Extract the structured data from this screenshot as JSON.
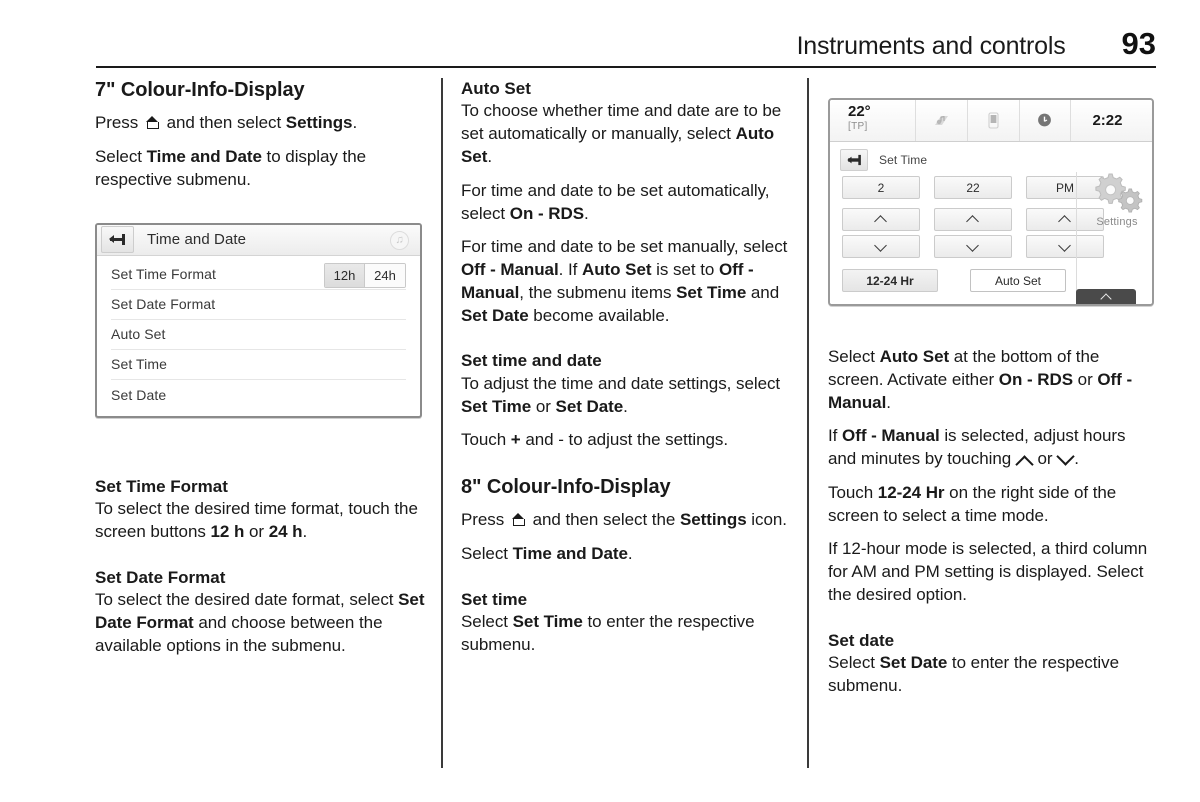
{
  "header": {
    "title": "Instruments and controls",
    "page_number": "93"
  },
  "col1": {
    "heading": "7\" Colour-Info-Display",
    "p1_a": "Press ",
    "p1_b": " and then select ",
    "p1_bold": "Settings",
    "p1_c": ".",
    "p2_a": "Select ",
    "p2_bold": "Time and Date",
    "p2_b": " to display the respective submenu.",
    "sub1_title": "Set Time Format",
    "sub1_a": "To select the desired time format, touch the screen buttons ",
    "sub1_b1": "12 h",
    "sub1_mid": " or ",
    "sub1_b2": "24 h",
    "sub1_end": ".",
    "sub2_title": "Set Date Format",
    "sub2_a": "To select the desired date format, select ",
    "sub2_bold": "Set Date Format",
    "sub2_b": " and choose between the available options in the submenu."
  },
  "menu_figure": {
    "back_icon": "back-arrow-icon",
    "title": "Time and Date",
    "music_icon": "♫",
    "rows": [
      {
        "label": "Set Time Format",
        "has_toggle": true
      },
      {
        "label": "Set Date Format",
        "has_toggle": false
      },
      {
        "label": "Auto Set",
        "has_toggle": false
      },
      {
        "label": "Set Time",
        "has_toggle": false
      },
      {
        "label": "Set Date",
        "has_toggle": false
      }
    ],
    "toggle_12h": "12h",
    "toggle_24h": "24h"
  },
  "col2": {
    "sub1_title": "Auto Set",
    "sub1_a": "To choose whether time and date are to be set automatically or manually, select ",
    "sub1_bold": "Auto Set",
    "sub1_end": ".",
    "p1_a": "For time and date to be set automatically, select ",
    "p1_bold": "On - RDS",
    "p1_end": ".",
    "p2_a": "For time and date to be set manually, select ",
    "p2_b1": "Off - Manual",
    "p2_b": ". If ",
    "p2_b2": "Auto Set",
    "p2_c": " is set to ",
    "p2_b3": "Off - Manual",
    "p2_d": ", the submenu items ",
    "p2_b4": "Set Time",
    "p2_e": " and ",
    "p2_b5": "Set Date",
    "p2_f": " become available.",
    "sub2_title": "Set time and date",
    "p3_a": "To adjust the time and date settings, select ",
    "p3_b1": "Set Time",
    "p3_mid": " or ",
    "p3_b2": "Set Date",
    "p3_end": ".",
    "p4_a": "Touch ",
    "p4_b": "+",
    "p4_c": " and - to adjust the settings.",
    "heading2": "8\" Colour-Info-Display",
    "p5_a": "Press ",
    "p5_b": " and then select the ",
    "p5_bold": "Settings",
    "p5_c": " icon.",
    "p6_a": "Select ",
    "p6_bold": "Time and Date",
    "p6_end": ".",
    "sub3_title": "Set time",
    "p7_a": "Select ",
    "p7_bold": "Set Time",
    "p7_b": " to enter the respective submenu."
  },
  "display_figure": {
    "temperature": "22°",
    "tp_indicator": "[TP]",
    "clock": "2:22",
    "status_icons": [
      "media-icon",
      "phone-icon",
      "info-icon"
    ],
    "back_icon": "back-arrow-icon",
    "screen_title": "Set Time",
    "columns": [
      {
        "value": "2",
        "up": "chevron-up-icon",
        "down": "chevron-down-icon"
      },
      {
        "value": "22",
        "up": "chevron-up-icon",
        "down": "chevron-down-icon"
      },
      {
        "value": "PM",
        "up": "chevron-up-icon",
        "down": "chevron-down-icon"
      }
    ],
    "btn_1224": "12-24 Hr",
    "btn_autoset": "Auto Set",
    "settings_label": "Settings",
    "settings_icon": "gears-icon",
    "bottom_tab_icon": "chevron-up-icon"
  },
  "col3": {
    "p1_a": "Select ",
    "p1_b1": "Auto Set",
    "p1_b": " at the bottom of the screen. Activate either ",
    "p1_b2": "On - RDS",
    "p1_c": " or ",
    "p1_b3": "Off - Manual",
    "p1_end": ".",
    "p2_a": "If ",
    "p2_b1": "Off - Manual",
    "p2_b": " is selected, adjust hours and minutes by touching ",
    "p2_c": " or ",
    "p2_end": ".",
    "p3_a": "Touch ",
    "p3_b1": "12-24 Hr",
    "p3_b": " on the right side of the screen to select a time mode.",
    "p4": "If 12-hour mode is selected, a third column for AM and PM setting is displayed. Select the desired option.",
    "sub_title": "Set date",
    "p5_a": "Select ",
    "p5_bold": "Set Date",
    "p5_b": " to enter the respective submenu."
  }
}
